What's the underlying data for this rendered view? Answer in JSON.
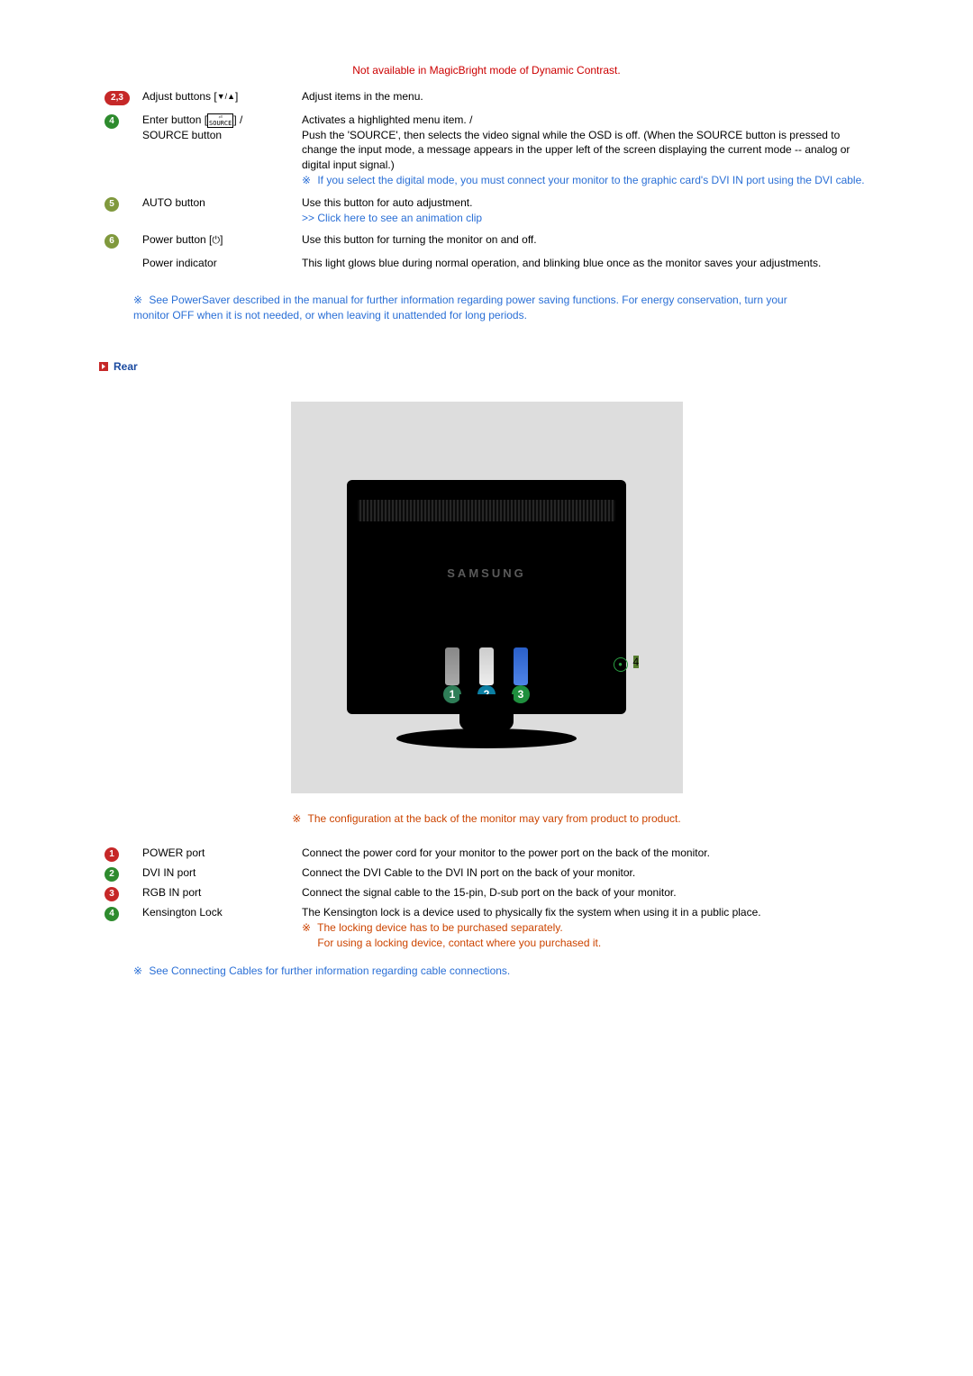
{
  "front": {
    "warning": "Not available in MagicBright mode of Dynamic Contrast.",
    "rows": [
      {
        "badge": "2,3",
        "badge_class": "badge-wide bg-red",
        "name_prefix": "Adjust buttons [",
        "name_glyphs": "▼/▲",
        "name_suffix": "]",
        "desc": "Adjust items in the menu."
      },
      {
        "badge": "4",
        "badge_class": "badge bg-green",
        "name_prefix": "Enter button [",
        "name_enter_top": "⏎",
        "name_enter_bottom": "SOURCE",
        "name_suffix": "] /",
        "name_line2": "SOURCE button",
        "desc": "Activates a highlighted menu item. /\nPush the 'SOURCE', then selects the video signal while the OSD is off. (When the SOURCE button is pressed to change the input mode, a message appears in the upper left of the screen displaying the current mode -- analog or digital input signal.)",
        "note": "If you select the digital mode, you must connect your monitor to the graphic card's DVI IN port using the DVI cable."
      },
      {
        "badge": "5",
        "badge_class": "badge bg-olive",
        "name": "AUTO button",
        "desc": "Use this button for auto adjustment.",
        "link": ">> Click here to see an animation clip"
      },
      {
        "badge": "6",
        "badge_class": "badge bg-olive",
        "name_prefix": "Power button [",
        "name_power": "⏻",
        "name_suffix": "]",
        "desc": "Use this button for turning the monitor on and off."
      },
      {
        "badge": "",
        "name": "Power indicator",
        "desc": "This light glows blue during normal operation, and blinking blue once as the monitor saves your adjustments."
      }
    ],
    "powersaver_note": "See PowerSaver described in the manual for further information regarding power saving functions. For energy conservation, turn your monitor OFF when it is not needed, or when leaving it unattended for long periods."
  },
  "rear": {
    "heading": "Rear",
    "brand": "SAMSUNG",
    "port_badges": [
      "1",
      "2",
      "3",
      "4"
    ],
    "config_note": "The configuration at the back of the monitor may vary from product to product.",
    "rows": [
      {
        "badge": "1",
        "badge_class": "badge bg-red",
        "name": "POWER port",
        "desc": "Connect the power cord for your monitor to the power port on the back of the monitor."
      },
      {
        "badge": "2",
        "badge_class": "badge bg-green",
        "name": "DVI IN port",
        "desc": "Connect the DVI Cable to the DVI IN port on the back of your monitor."
      },
      {
        "badge": "3",
        "badge_class": "badge bg-red",
        "name": "RGB IN port",
        "desc": "Connect the signal cable to the 15-pin, D-sub port on the back of your monitor."
      },
      {
        "badge": "4",
        "badge_class": "badge bg-green",
        "name": "Kensington Lock",
        "desc": "The Kensington lock is a device used to physically fix the system when using it in a public place.",
        "note1": "The locking device has to be purchased separately.",
        "note2": "For using a locking device, contact where you purchased it."
      }
    ],
    "see_cables_prefix": "See ",
    "see_cables_link": "Connecting Cables",
    "see_cables_suffix": " for further information regarding cable connections."
  }
}
